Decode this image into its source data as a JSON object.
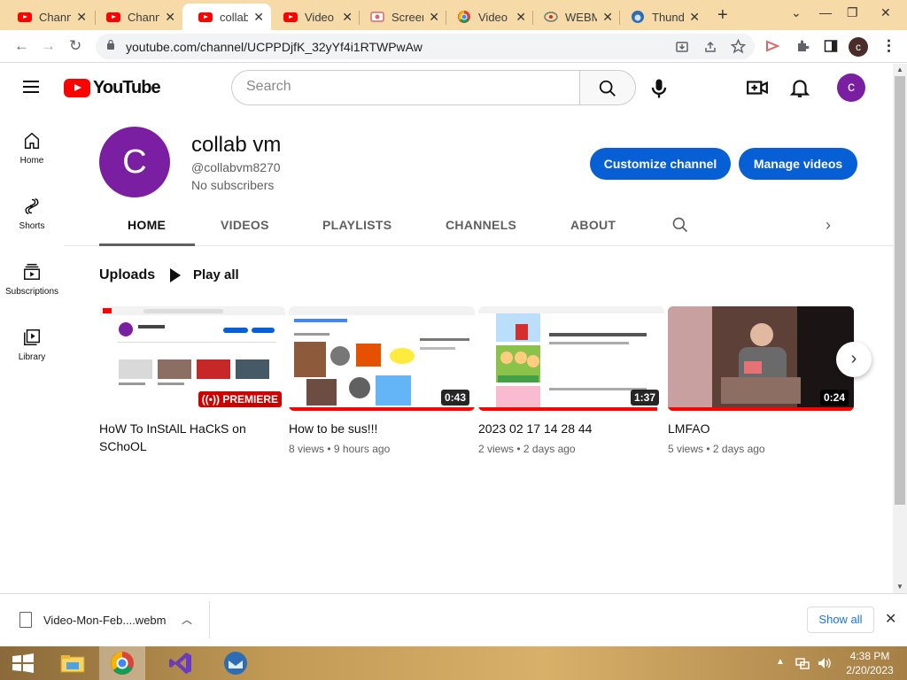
{
  "browser": {
    "tabs": [
      {
        "title": "Chann",
        "icon": "youtube-icon"
      },
      {
        "title": "Chann",
        "icon": "youtube-icon"
      },
      {
        "title": "collab",
        "icon": "youtube-icon",
        "active": true
      },
      {
        "title": "Video",
        "icon": "youtube-icon"
      },
      {
        "title": "Screen",
        "icon": "screencast-icon"
      },
      {
        "title": "Video",
        "icon": "chrome-icon"
      },
      {
        "title": "WEBM",
        "icon": "webm-icon"
      },
      {
        "title": "Thund",
        "icon": "thunderbird-icon"
      }
    ],
    "url": "youtube.com/channel/UCPPDjfK_32yYf4i1RTWPwAw",
    "profile_initial": "c"
  },
  "youtube": {
    "logo_text": "YouTube",
    "search_placeholder": "Search",
    "user_initial": "c",
    "guide": [
      {
        "label": "Home",
        "icon": "home-icon"
      },
      {
        "label": "Shorts",
        "icon": "shorts-icon"
      },
      {
        "label": "Subscriptions",
        "icon": "subscriptions-icon"
      },
      {
        "label": "Library",
        "icon": "library-icon"
      }
    ],
    "channel": {
      "initial": "C",
      "name": "collab vm",
      "handle": "@collabvm8270",
      "subscribers": "No subscribers",
      "customize_label": "Customize channel",
      "manage_label": "Manage videos"
    },
    "tabs": [
      "HOME",
      "VIDEOS",
      "PLAYLISTS",
      "CHANNELS",
      "ABOUT"
    ],
    "active_tab": "HOME",
    "uploads_title": "Uploads",
    "play_all_label": "Play all",
    "videos": [
      {
        "title": "HoW To InStAlL HaCkS on SChoOL",
        "badge": "PREMIERE",
        "meta": ""
      },
      {
        "title": "How to be sus!!!",
        "duration": "0:43",
        "meta": "8 views • 9 hours ago"
      },
      {
        "title": "2023 02 17 14 28 44",
        "duration": "1:37",
        "meta": "2 views • 2 days ago"
      },
      {
        "title": "LMFAO",
        "duration": "0:24",
        "meta": "5 views • 2 days ago"
      }
    ],
    "accent_color": "#065fd4",
    "brand_color": "#ff0000"
  },
  "download_bar": {
    "file_name": "Video-Mon-Feb....webm",
    "show_all_label": "Show all"
  },
  "taskbar": {
    "time": "4:38 PM",
    "date": "2/20/2023"
  }
}
